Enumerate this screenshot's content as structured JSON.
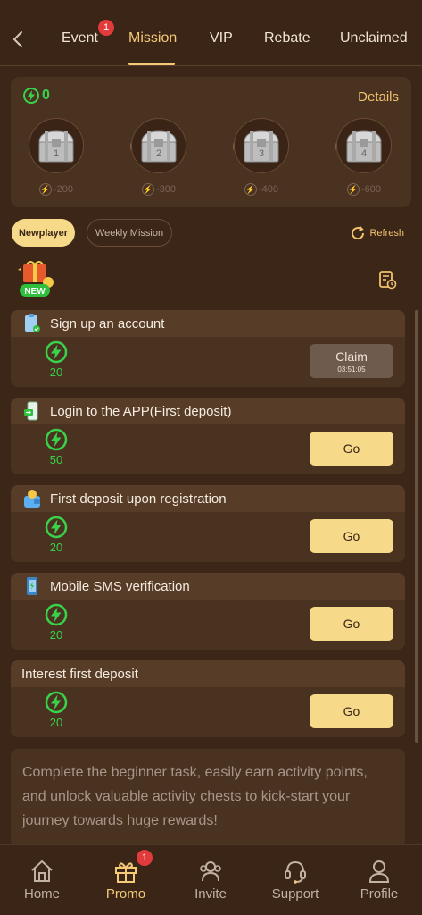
{
  "topbar": {
    "tabs": [
      {
        "label": "Event",
        "badge": "1"
      },
      {
        "label": "Mission",
        "active": true
      },
      {
        "label": "VIP"
      },
      {
        "label": "Rebate"
      },
      {
        "label": "Unclaimed"
      }
    ]
  },
  "chest_panel": {
    "points": "0",
    "details_label": "Details",
    "chests": [
      {
        "number": "1",
        "cost": "-200"
      },
      {
        "number": "2",
        "cost": "-300"
      },
      {
        "number": "3",
        "cost": "-400"
      },
      {
        "number": "4",
        "cost": "-600"
      }
    ]
  },
  "subtabs": {
    "newplayer": "Newplayer",
    "weekly": "Weekly Mission",
    "refresh": "Refresh"
  },
  "new_badge": "NEW",
  "tasks": [
    {
      "title": "Sign up an account",
      "reward": "20",
      "action": "Claim",
      "timer": "03:51:05",
      "icon": "clipboard-check-icon"
    },
    {
      "title": "Login to the APP(First deposit)",
      "reward": "50",
      "action": "Go",
      "icon": "phone-login-icon"
    },
    {
      "title": "First deposit upon registration",
      "reward": "20",
      "action": "Go",
      "icon": "wallet-coin-icon"
    },
    {
      "title": "Mobile SMS verification",
      "reward": "20",
      "action": "Go",
      "icon": "sms-phone-icon"
    },
    {
      "title": "Interest first deposit",
      "reward": "20",
      "action": "Go"
    }
  ],
  "description": "Complete the beginner task, easily earn activity points, and unlock valuable activity chests to kick-start your journey towards huge rewards!",
  "bottomnav": {
    "items": [
      {
        "label": "Home",
        "icon": "home-icon"
      },
      {
        "label": "Promo",
        "icon": "gift-icon",
        "badge": "1",
        "active": true
      },
      {
        "label": "Invite",
        "icon": "people-icon"
      },
      {
        "label": "Support",
        "icon": "headset-icon"
      },
      {
        "label": "Profile",
        "icon": "user-icon"
      }
    ]
  },
  "colors": {
    "background": "#3b2618",
    "panel": "#4a3221",
    "accent": "#f4c978",
    "button": "#f7d98a",
    "green": "#39d24a",
    "badge": "#e23b3b"
  }
}
